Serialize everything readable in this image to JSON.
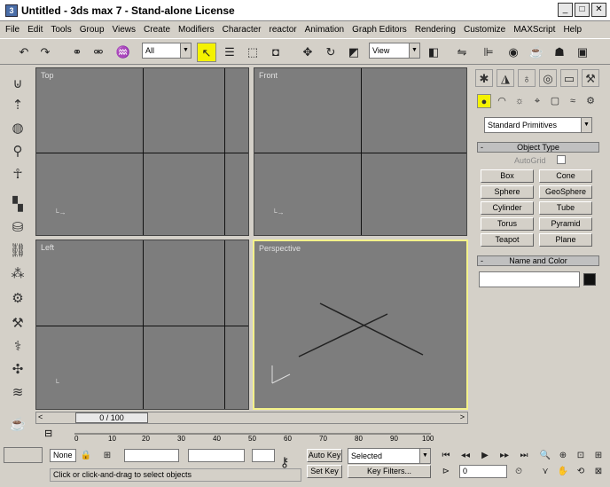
{
  "window": {
    "title": "Untitled - 3ds max 7 - Stand-alone License"
  },
  "menu": [
    "File",
    "Edit",
    "Tools",
    "Group",
    "Views",
    "Create",
    "Modifiers",
    "Character",
    "reactor",
    "Animation",
    "Graph Editors",
    "Rendering",
    "Customize",
    "MAXScript",
    "Help"
  ],
  "toolbar": {
    "selection_filter": "All",
    "coord_system": "View"
  },
  "viewports": {
    "top": "Top",
    "front": "Front",
    "left": "Left",
    "perspective": "Perspective"
  },
  "command_panel": {
    "category": "Standard Primitives",
    "object_type_title": "Object Type",
    "autogrid": "AutoGrid",
    "buttons": [
      "Box",
      "Cone",
      "Sphere",
      "GeoSphere",
      "Cylinder",
      "Tube",
      "Torus",
      "Pyramid",
      "Teapot",
      "Plane"
    ],
    "name_color_title": "Name and Color"
  },
  "timeline": {
    "slider": "0 / 100",
    "ticks": [
      "0",
      "10",
      "20",
      "30",
      "40",
      "50",
      "60",
      "70",
      "80",
      "90",
      "100"
    ]
  },
  "status": {
    "selection": "None",
    "auto_key": "Auto Key",
    "set_key": "Set Key",
    "selected_dropdown": "Selected",
    "key_filters": "Key Filters...",
    "frame": "0",
    "prompt": "Click or click-and-drag to select objects"
  },
  "colors": {
    "viewport_bg": "#7d7d7d",
    "active_border": "#f4f28a",
    "active_tool": "#f4f200"
  }
}
